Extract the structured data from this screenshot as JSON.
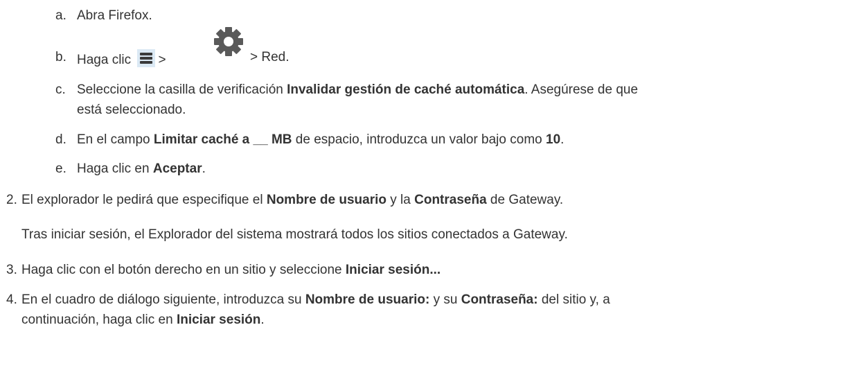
{
  "steps": {
    "a": {
      "marker": "a.",
      "text": "Abra Firefox."
    },
    "b": {
      "marker": "b.",
      "pre": "Haga clic",
      "sep1": ">",
      "post": "> Red."
    },
    "c": {
      "marker": "c.",
      "pre": "Seleccione la casilla de verificación ",
      "bold": "Invalidar gestión de caché automática",
      "post": ". Asegúrese de que",
      "line2": "está seleccionado."
    },
    "d": {
      "marker": "d.",
      "pre": "En el campo ",
      "bold1": "Limitar caché a __ MB",
      "mid": " de espacio, introduzca un valor bajo como ",
      "bold2": "10",
      "post": "."
    },
    "e": {
      "marker": "e.",
      "pre": "Haga clic en ",
      "bold": "Aceptar",
      "post": "."
    },
    "s2": {
      "marker": "2.",
      "pre": "El explorador le pedirá que especifique el ",
      "bold1": "Nombre de usuario",
      "mid": " y la ",
      "bold2": "Contraseña",
      "post": " de Gateway.",
      "para": "Tras iniciar sesión, el Explorador del sistema mostrará todos los sitios conectados a Gateway."
    },
    "s3": {
      "marker": "3.",
      "pre": "Haga clic con el botón derecho en un sitio y seleccione ",
      "bold": "Iniciar sesión..."
    },
    "s4": {
      "marker": "4.",
      "pre": "En el cuadro de diálogo siguiente, introduzca su ",
      "bold1": "Nombre de usuario:",
      "mid": " y su ",
      "bold2": "Contraseña:",
      "post": " del sitio y, a",
      "line2pre": "continuación, haga clic en ",
      "line2bold": "Iniciar sesión",
      "line2post": "."
    }
  },
  "icons": {
    "menu": "hamburger-menu-icon",
    "gear": "gear-icon"
  },
  "colors": {
    "text": "#333333",
    "menu_bg": "#dbe9f4",
    "gear": "#5a5a5a"
  }
}
